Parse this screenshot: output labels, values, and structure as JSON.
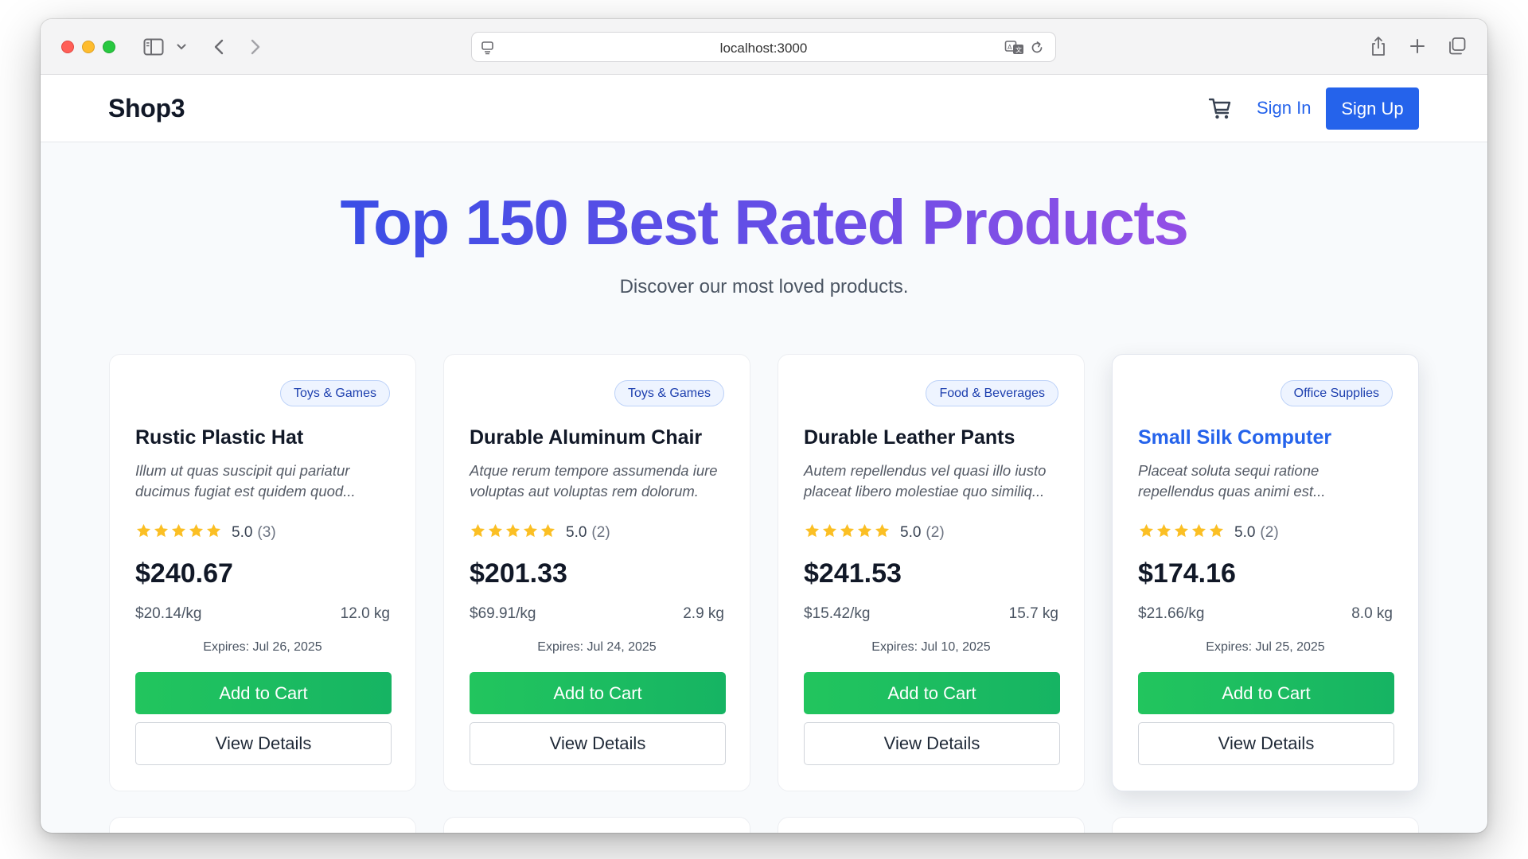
{
  "browser": {
    "url": "localhost:3000"
  },
  "header": {
    "logo": "Shop3",
    "sign_in": "Sign In",
    "sign_up": "Sign Up"
  },
  "hero": {
    "title": "Top 150 Best Rated Products",
    "subtitle": "Discover our most loved products."
  },
  "colors": {
    "primary": "#2563eb",
    "add_to_cart": "#22c55e",
    "star": "#fbbf24",
    "badge_bg": "#eef4ff",
    "title_gradient_start": "#3b4ee6",
    "title_gradient_end": "#9450e6"
  },
  "products": [
    {
      "category": "Toys & Games",
      "name": "Rustic Plastic Hat",
      "description": "Illum ut quas suscipit qui pariatur ducimus fugiat est quidem quod...",
      "stars": 5,
      "rating": "5.0",
      "review_count": "(3)",
      "price": "$240.67",
      "unit_price": "$20.14/kg",
      "weight": "12.0 kg",
      "expires": "Expires: Jul 26, 2025",
      "add_label": "Add to Cart",
      "details_label": "View Details"
    },
    {
      "category": "Toys & Games",
      "name": "Durable Aluminum Chair",
      "description": "Atque rerum tempore assumenda iure voluptas aut voluptas rem dolorum.",
      "stars": 5,
      "rating": "5.0",
      "review_count": "(2)",
      "price": "$201.33",
      "unit_price": "$69.91/kg",
      "weight": "2.9 kg",
      "expires": "Expires: Jul 24, 2025",
      "add_label": "Add to Cart",
      "details_label": "View Details"
    },
    {
      "category": "Food & Beverages",
      "name": "Durable Leather Pants",
      "description": "Autem repellendus vel quasi illo iusto placeat libero molestiae quo similiq...",
      "stars": 5,
      "rating": "5.0",
      "review_count": "(2)",
      "price": "$241.53",
      "unit_price": "$15.42/kg",
      "weight": "15.7 kg",
      "expires": "Expires: Jul 10, 2025",
      "add_label": "Add to Cart",
      "details_label": "View Details"
    },
    {
      "category": "Office Supplies",
      "name": "Small Silk Computer",
      "description": "Placeat soluta sequi ratione repellendus quas animi est...",
      "stars": 5,
      "rating": "5.0",
      "review_count": "(2)",
      "price": "$174.16",
      "unit_price": "$21.66/kg",
      "weight": "8.0 kg",
      "expires": "Expires: Jul 25, 2025",
      "add_label": "Add to Cart",
      "details_label": "View Details"
    }
  ]
}
